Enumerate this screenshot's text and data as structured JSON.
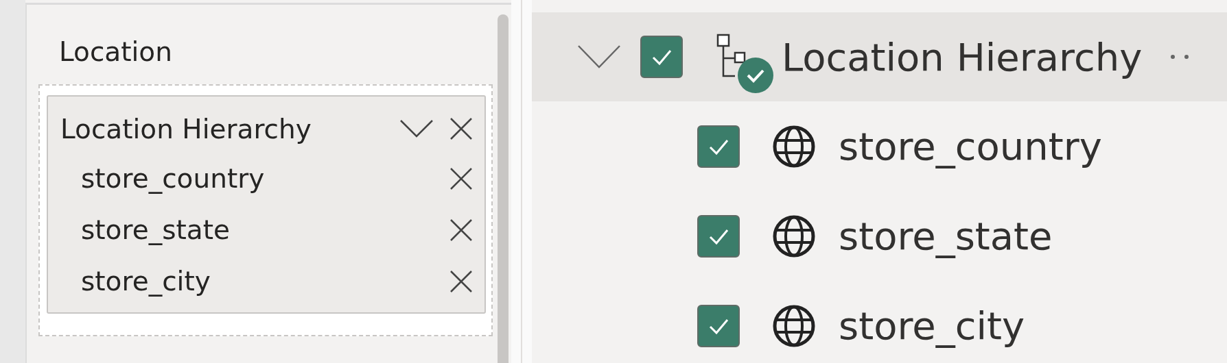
{
  "well": {
    "title": "Location",
    "field": {
      "name": "Location Hierarchy",
      "expanded": true,
      "levels": [
        {
          "name": "store_country"
        },
        {
          "name": "store_state"
        },
        {
          "name": "store_city"
        }
      ]
    }
  },
  "fields_tree": {
    "items": [
      {
        "name": "Location Hierarchy",
        "checked": true,
        "expanded": true,
        "selected": true,
        "children": [
          {
            "name": "store_country",
            "checked": true,
            "selected": false
          },
          {
            "name": "store_state",
            "checked": true,
            "selected": false
          },
          {
            "name": "store_city",
            "checked": true,
            "selected": false
          }
        ]
      }
    ]
  }
}
